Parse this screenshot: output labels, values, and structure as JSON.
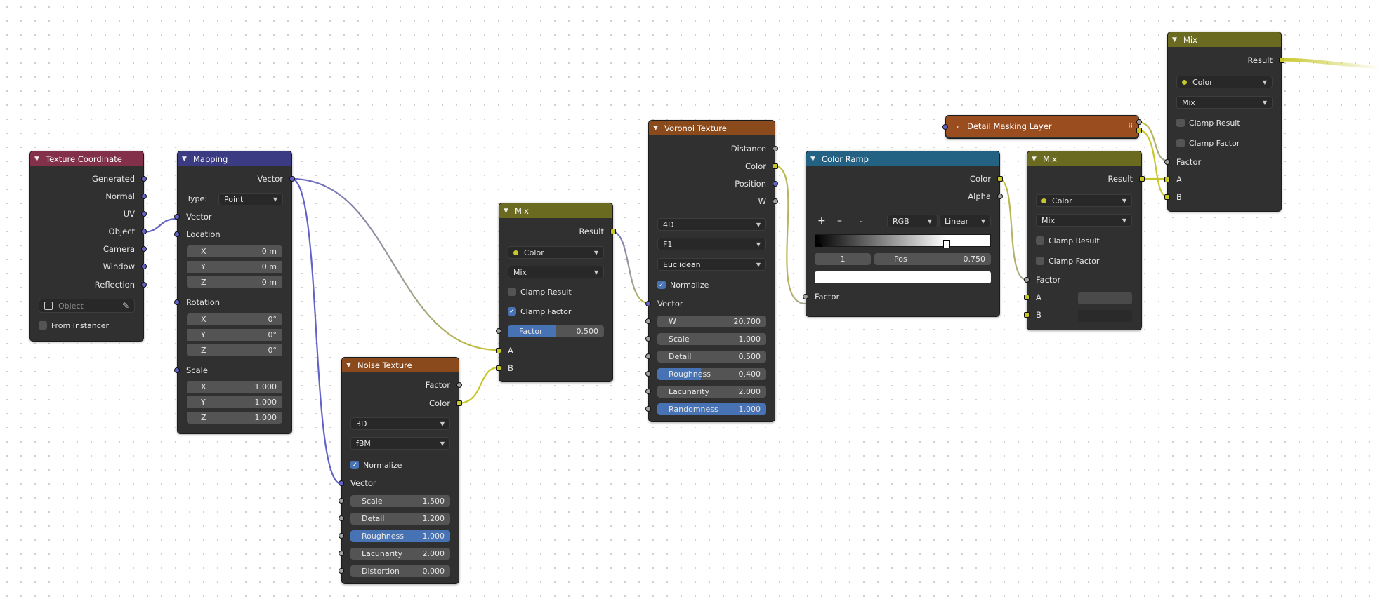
{
  "nodes": {
    "texcoord": {
      "title": "Texture Coordinate",
      "outputs": [
        "Generated",
        "Normal",
        "UV",
        "Object",
        "Camera",
        "Window",
        "Reflection"
      ],
      "object_placeholder": "Object",
      "from_instancer": "From Instancer"
    },
    "mapping": {
      "title": "Mapping",
      "out_vector": "Vector",
      "type_label": "Type:",
      "type_value": "Point",
      "in_vector": "Vector",
      "location": "Location",
      "loc": [
        {
          "a": "X",
          "v": "0 m"
        },
        {
          "a": "Y",
          "v": "0 m"
        },
        {
          "a": "Z",
          "v": "0 m"
        }
      ],
      "rotation": "Rotation",
      "rot": [
        {
          "a": "X",
          "v": "0°"
        },
        {
          "a": "Y",
          "v": "0°"
        },
        {
          "a": "Z",
          "v": "0°"
        }
      ],
      "scale": "Scale",
      "scl": [
        {
          "a": "X",
          "v": "1.000"
        },
        {
          "a": "Y",
          "v": "1.000"
        },
        {
          "a": "Z",
          "v": "1.000"
        }
      ]
    },
    "noise": {
      "title": "Noise Texture",
      "outputs": [
        "Factor",
        "Color"
      ],
      "dim": "3D",
      "type": "fBM",
      "normalize": "Normalize",
      "vector": "Vector",
      "fields": [
        {
          "label": "Scale",
          "value": "1.500"
        },
        {
          "label": "Detail",
          "value": "1.200"
        },
        {
          "label": "Roughness",
          "value": "1.000",
          "fill": 1.0
        },
        {
          "label": "Lacunarity",
          "value": "2.000"
        },
        {
          "label": "Distortion",
          "value": "0.000"
        }
      ]
    },
    "mix1": {
      "title": "Mix",
      "result": "Result",
      "dtype": "Color",
      "blend": "Mix",
      "clamp_result": "Clamp Result",
      "clamp_factor": "Clamp Factor",
      "factor_label": "Factor",
      "factor_value": "0.500",
      "factor_fill": 0.5,
      "a": "A",
      "b": "B"
    },
    "voronoi": {
      "title": "Voronoi Texture",
      "outputs": [
        "Distance",
        "Color",
        "Position",
        "W"
      ],
      "dim": "4D",
      "feature": "F1",
      "metric": "Euclidean",
      "normalize": "Normalize",
      "vector": "Vector",
      "fields": [
        {
          "label": "W",
          "value": "20.700"
        },
        {
          "label": "Scale",
          "value": "1.000"
        },
        {
          "label": "Detail",
          "value": "0.500"
        },
        {
          "label": "Roughness",
          "value": "0.400",
          "fill": 0.4
        },
        {
          "label": "Lacunarity",
          "value": "2.000"
        },
        {
          "label": "Randomness",
          "value": "1.000",
          "fill": 1.0
        }
      ]
    },
    "ramp": {
      "title": "Color Ramp",
      "outputs": [
        "Color",
        "Alpha"
      ],
      "plus": "+",
      "minus": "–",
      "mode": "RGB",
      "interp": "Linear",
      "index": "1",
      "pos_label": "Pos",
      "pos_value": "0.750",
      "factor": "Factor"
    },
    "mix2": {
      "title": "Mix",
      "result": "Result",
      "dtype": "Color",
      "blend": "Mix",
      "clamp_result": "Clamp Result",
      "clamp_factor": "Clamp Factor",
      "factor": "Factor",
      "a": "A",
      "b": "B"
    },
    "detail": {
      "title": "Detail Masking Layer"
    },
    "mix3": {
      "title": "Mix",
      "result": "Result",
      "dtype": "Color",
      "blend": "Mix",
      "clamp_result": "Clamp Result",
      "clamp_factor": "Clamp Factor",
      "factor": "Factor",
      "a": "A",
      "b": "B"
    }
  },
  "colors": {
    "header_input": "#83314a",
    "header_vector": "#3b3b83",
    "header_texture": "#8a4a1c",
    "header_color": "#6a6a20",
    "header_converter": "#246283",
    "header_group": "#9a4d1f",
    "socket_vector": "#6363c7",
    "socket_color": "#c7c729",
    "socket_float": "#a1a1a1",
    "slider_fill": "#4772b3"
  }
}
